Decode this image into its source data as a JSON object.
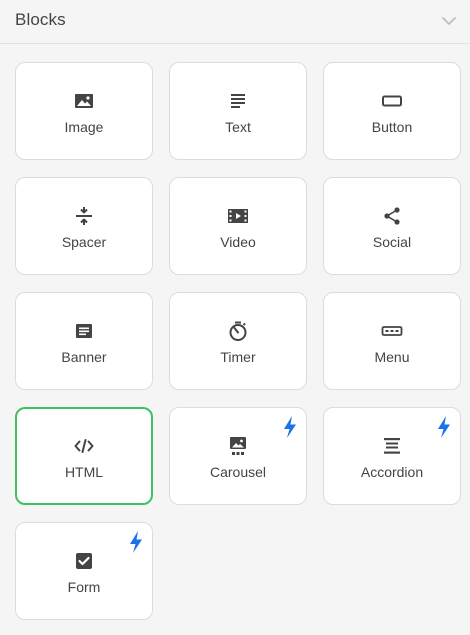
{
  "panel": {
    "title": "Blocks",
    "toggle_icon": "chevron-down-icon"
  },
  "colors": {
    "icon": "#444444",
    "selected_border": "#3cc35f",
    "premium_bolt": "#1a73e8"
  },
  "blocks": [
    {
      "label": "Image",
      "icon": "image-icon",
      "premium": false,
      "selected": false
    },
    {
      "label": "Text",
      "icon": "text-icon",
      "premium": false,
      "selected": false
    },
    {
      "label": "Button",
      "icon": "button-icon",
      "premium": false,
      "selected": false
    },
    {
      "label": "Spacer",
      "icon": "spacer-icon",
      "premium": false,
      "selected": false
    },
    {
      "label": "Video",
      "icon": "video-icon",
      "premium": false,
      "selected": false
    },
    {
      "label": "Social",
      "icon": "share-icon",
      "premium": false,
      "selected": false
    },
    {
      "label": "Banner",
      "icon": "banner-icon",
      "premium": false,
      "selected": false
    },
    {
      "label": "Timer",
      "icon": "timer-icon",
      "premium": false,
      "selected": false
    },
    {
      "label": "Menu",
      "icon": "menu-icon",
      "premium": false,
      "selected": false
    },
    {
      "label": "HTML",
      "icon": "code-icon",
      "premium": false,
      "selected": true
    },
    {
      "label": "Carousel",
      "icon": "carousel-icon",
      "premium": true,
      "selected": false
    },
    {
      "label": "Accordion",
      "icon": "accordion-icon",
      "premium": true,
      "selected": false
    },
    {
      "label": "Form",
      "icon": "checkbox-icon",
      "premium": true,
      "selected": false
    }
  ]
}
